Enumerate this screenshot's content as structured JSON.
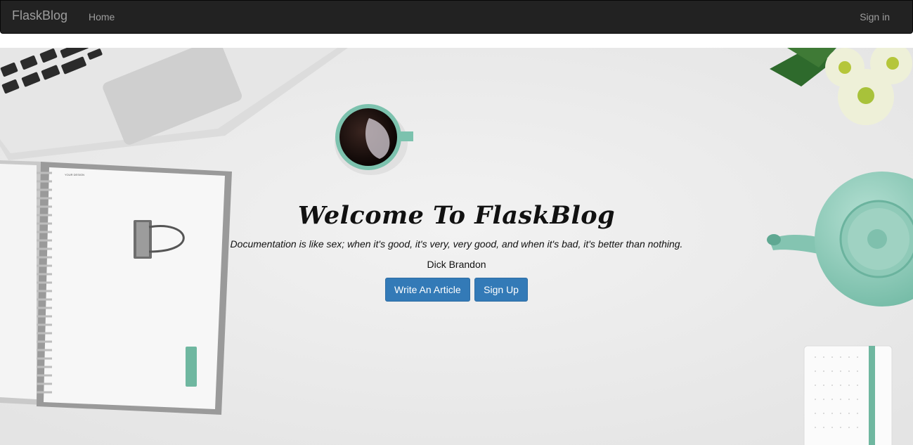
{
  "navbar": {
    "brand": "FlaskBlog",
    "home_label": "Home",
    "signin_label": "Sign in"
  },
  "hero": {
    "title": "Welcome To FlaskBlog",
    "quote": "Documentation is like sex; when it's good, it's very, very good, and when it's bad, it's better than nothing.",
    "author": "Dick Brandon",
    "write_button": "Write An Article",
    "signup_button": "Sign Up"
  },
  "decor": {
    "notebook_cover_text": "YOUR DESIGN"
  },
  "colors": {
    "navbar_bg": "#222222",
    "nav_text": "#9d9d9d",
    "button_primary": "#337ab7",
    "accent_mint": "#7cc2ae"
  }
}
